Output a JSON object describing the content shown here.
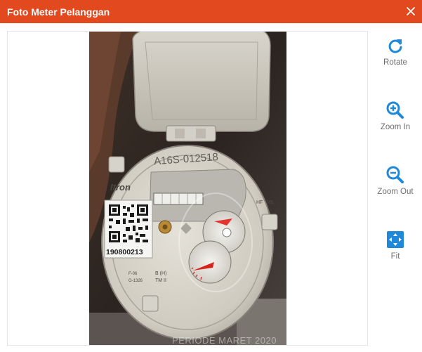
{
  "dialog": {
    "title": "Foto Meter Pelanggan"
  },
  "photo": {
    "meter_serial": "A16S-012518",
    "brand": "Itron",
    "qr_number": "190800213",
    "small_label_1": "HF",
    "small_label_2": "10L",
    "mark_1": "F-06",
    "mark_2": "G-1326",
    "mark_3": "B (H)",
    "mark_4": "TM II",
    "watermark": "PERIODE MARET 2020"
  },
  "tools": [
    {
      "label": "Rotate",
      "icon": "rotate-icon"
    },
    {
      "label": "Zoom In",
      "icon": "zoom-in-icon"
    },
    {
      "label": "Zoom Out",
      "icon": "zoom-out-icon"
    },
    {
      "label": "Fit",
      "icon": "fit-icon"
    }
  ],
  "colors": {
    "header": "#e2491f",
    "icon_blue": "#1e88d9"
  }
}
